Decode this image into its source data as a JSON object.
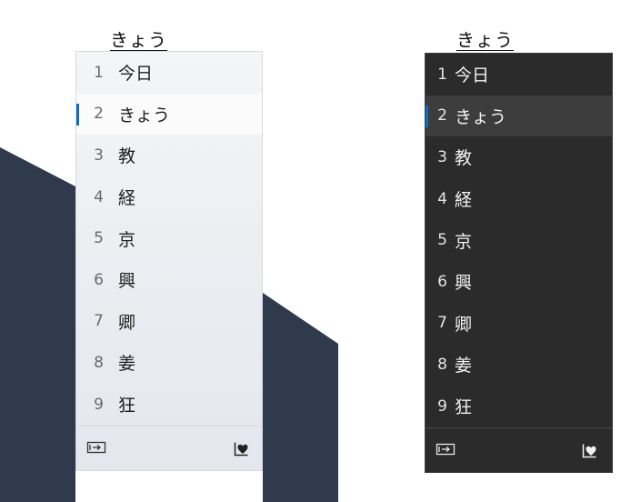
{
  "composition": "きょう",
  "candidates": [
    {
      "index": "1",
      "text": "今日"
    },
    {
      "index": "2",
      "text": "きょう"
    },
    {
      "index": "3",
      "text": "教"
    },
    {
      "index": "4",
      "text": "経"
    },
    {
      "index": "5",
      "text": "京"
    },
    {
      "index": "6",
      "text": "興"
    },
    {
      "index": "7",
      "text": "卿"
    },
    {
      "index": "8",
      "text": "姜"
    },
    {
      "index": "9",
      "text": "狂"
    }
  ],
  "selected_index": 2,
  "footer": {
    "left_icon": "expand-candidates-icon",
    "right_icon": "emoji-heart-icon"
  },
  "colors": {
    "accent": "#0a6cc7",
    "background_shape": "#2f3a4d",
    "dark_panel": "#2b2b2b",
    "light_panel": "#eef0f3"
  }
}
